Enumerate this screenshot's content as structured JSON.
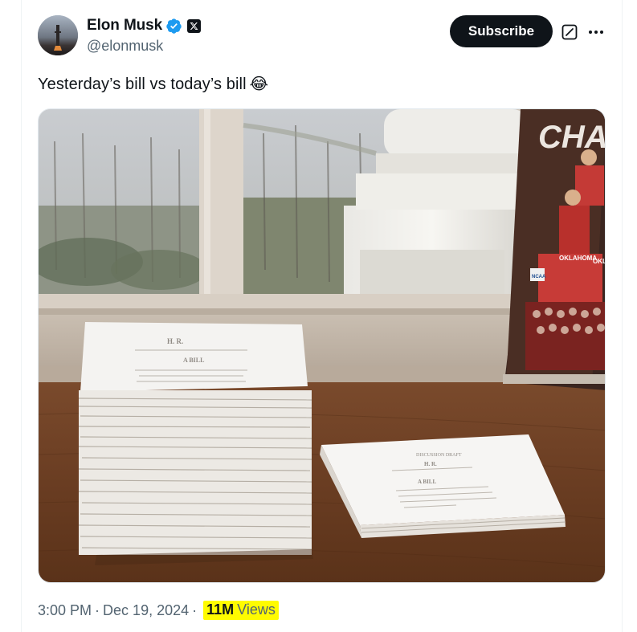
{
  "author": {
    "name": "Elon Musk",
    "handle": "@elonmusk",
    "verified_icon": "verified-badge-icon",
    "affiliate_icon": "x-logo-icon"
  },
  "actions": {
    "subscribe_label": "Subscribe",
    "grok_icon": "grok-icon",
    "more_icon": "more-icon"
  },
  "tweet": {
    "text": "Yesterday’s bill vs today’s bill",
    "emoji": "😂"
  },
  "photo": {
    "poster_text": "CHA",
    "poster_lines": [
      "OKLAHOMA",
      "OKL",
      "NCAA"
    ],
    "doc_left_lines": [
      "H. R.",
      "A BILL"
    ],
    "doc_right_lines": [
      "DISCUSSION DRAFT",
      "H. R.",
      "A BILL"
    ]
  },
  "meta": {
    "time": "3:00 PM",
    "date": "Dec 19, 2024",
    "separator": "·",
    "views_count": "11M",
    "views_label": "Views"
  },
  "colors": {
    "subscribe_bg": "#0f1419",
    "verified_blue": "#1d9bf0",
    "secondary_text": "#536471",
    "highlight": "#fffb00"
  }
}
